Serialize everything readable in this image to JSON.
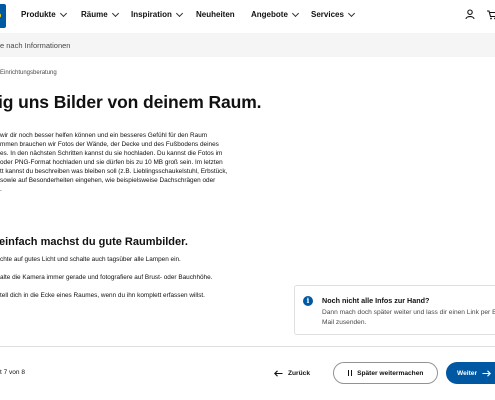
{
  "header": {
    "nav": [
      {
        "label": "Produkte",
        "has_dropdown": true
      },
      {
        "label": "Räume",
        "has_dropdown": true
      },
      {
        "label": "Inspiration",
        "has_dropdown": true
      },
      {
        "label": "Neuheiten",
        "has_dropdown": false
      },
      {
        "label": "Angebote",
        "has_dropdown": true
      },
      {
        "label": "Services",
        "has_dropdown": true
      }
    ],
    "icons": [
      "user-icon",
      "cart-icon"
    ],
    "brand_color": "#0058a3",
    "brand_accent": "#ffdb00"
  },
  "search": {
    "placeholder": "e nach Informationen"
  },
  "breadcrumb": "Einrichtungsberatung",
  "main": {
    "title": "ig uns Bilder von deinem Raum.",
    "paragraph_lines": [
      "wir dir noch besser helfen können und ein besseres Gefühl für den Raum",
      "mmen brauchen wir Fotos der Wände, der Decke und des Fußbodens deines",
      "es. In den nächsten Schritten kannst du sie hochladen. Du kannst die Fotos im",
      "oder PNG-Format hochladen und sie dürfen bis zu 10 MB groß sein. Im letzten",
      "tt kannst du beschreiben was bleiben soll (z.B. Lieblingsschaukelstuhl, Erbstück,",
      "sowie auf Besonderheiten eingehen, wie beispielsweise Dachschrägen oder",
      "."
    ],
    "subtitle": "einfach machst du gute Raumbilder.",
    "tips": [
      "chte auf gutes Licht und schalte auch tagsüber alle Lampen ein.",
      "alte die Kamera immer gerade und fotografiere auf Brust- oder Bauchhöhe.",
      "tell dich in die Ecke eines Raumes, wenn du ihn komplett erfassen willst."
    ]
  },
  "info_box": {
    "icon": "info-icon",
    "title": "Noch nicht alle Infos zur Hand?",
    "text": "Dann mach doch später weiter und lass dir einen Link per E-Mail zusenden."
  },
  "footer": {
    "step_text": "t 7 von 8",
    "back_label": "Zurück",
    "later_label": "Später weitermachen",
    "next_label": "Weiter",
    "primary_color": "#0058a3"
  }
}
